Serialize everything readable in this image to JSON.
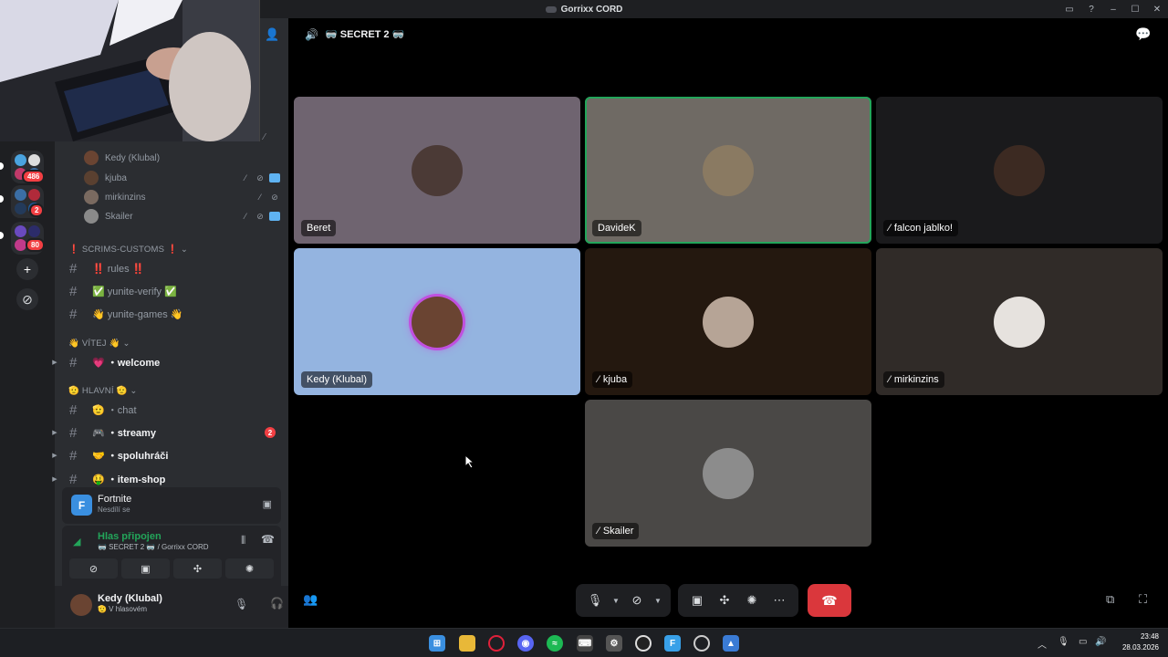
{
  "app": {
    "title": "Gorrixx CORD"
  },
  "window_controls": {
    "minimize": "–",
    "maximize": "☐",
    "close": "✕"
  },
  "rail": {
    "badges": [
      "486",
      "2",
      "80"
    ],
    "add_label": "+",
    "discover_label": "⊘"
  },
  "voice_users": [
    {
      "name": "Kedy (Klubal)",
      "icons": []
    },
    {
      "name": "kjuba",
      "icons": [
        "deafen",
        "nocam",
        "live"
      ]
    },
    {
      "name": "mirkinzins",
      "icons": [
        "deafen",
        "nocam"
      ]
    },
    {
      "name": "Skailer",
      "icons": [
        "deafen",
        "nocam",
        "live"
      ]
    }
  ],
  "categories": {
    "scrims": "❗ SCRIMS-CUSTOMS ❗ ⌄",
    "vitej": "👋 VÍTEJ 👋 ⌄",
    "hlavni": "🫡 HLAVNÍ 🫡 ⌄"
  },
  "channels": [
    {
      "label": "‼️ rules ‼️",
      "unread": false,
      "arrow": "",
      "count": ""
    },
    {
      "label": "✅ yunite-verify ✅",
      "unread": false,
      "arrow": "",
      "count": ""
    },
    {
      "label": "👋 yunite-games 👋",
      "unread": false,
      "arrow": "",
      "count": ""
    },
    {
      "label": "💗 ・welcome",
      "unread": true,
      "arrow": "▶",
      "count": ""
    },
    {
      "label": "🫡 ・chat",
      "unread": false,
      "arrow": "",
      "count": ""
    },
    {
      "label": "🎮 ・streamy",
      "unread": true,
      "arrow": "▶",
      "count": "2"
    },
    {
      "label": "🤝 ・spoluhráči",
      "unread": true,
      "arrow": "▶",
      "count": ""
    },
    {
      "label": "🤑 ・item-shop",
      "unread": true,
      "arrow": "▶",
      "count": ""
    }
  ],
  "activity": {
    "game": "Fortnite",
    "status": "Nesdílí se",
    "icon_letter": "F"
  },
  "voice_panel": {
    "status": "Hlas připojen",
    "location": "🥽 SECRET 2 🥽 / Gorrixx CORD"
  },
  "user_panel": {
    "name": "Kedy (Klubal)",
    "status": "🫡 V hlasovém"
  },
  "channel_header": {
    "name": "🥽 SECRET 2 🥽"
  },
  "tiles": [
    {
      "name": "Beret",
      "bg": "#6f6470",
      "avatar": "#4b3a36",
      "speaking": false,
      "icon": ""
    },
    {
      "name": "DavideK",
      "bg": "#6f6a64",
      "avatar": "#8a7a62",
      "speaking": true,
      "icon": ""
    },
    {
      "name": "falcon jablko!",
      "bg": "#1a1a1c",
      "avatar": "#3c2a22",
      "speaking": false,
      "icon": "⁄"
    },
    {
      "name": "Kedy (Klubal)",
      "bg": "#94b4e0",
      "avatar": "#6a4432",
      "speaking": false,
      "icon": ""
    },
    {
      "name": "kjuba",
      "bg": "#24180f",
      "avatar": "#b6a496",
      "speaking": false,
      "icon": "⁄"
    },
    {
      "name": "mirkinzins",
      "bg": "#302b28",
      "avatar": "#e6e2de",
      "speaking": false,
      "icon": "⁄"
    },
    {
      "name": "Skailer",
      "bg": "#4a4846",
      "avatar": "#8c8c8c",
      "speaking": false,
      "icon": "⁄"
    }
  ],
  "taskbar": {
    "time": "23:48",
    "date": "28.03.2026"
  },
  "colors": {
    "accent": "#5865f2",
    "danger": "#da373c",
    "speaking": "#23a55a"
  }
}
